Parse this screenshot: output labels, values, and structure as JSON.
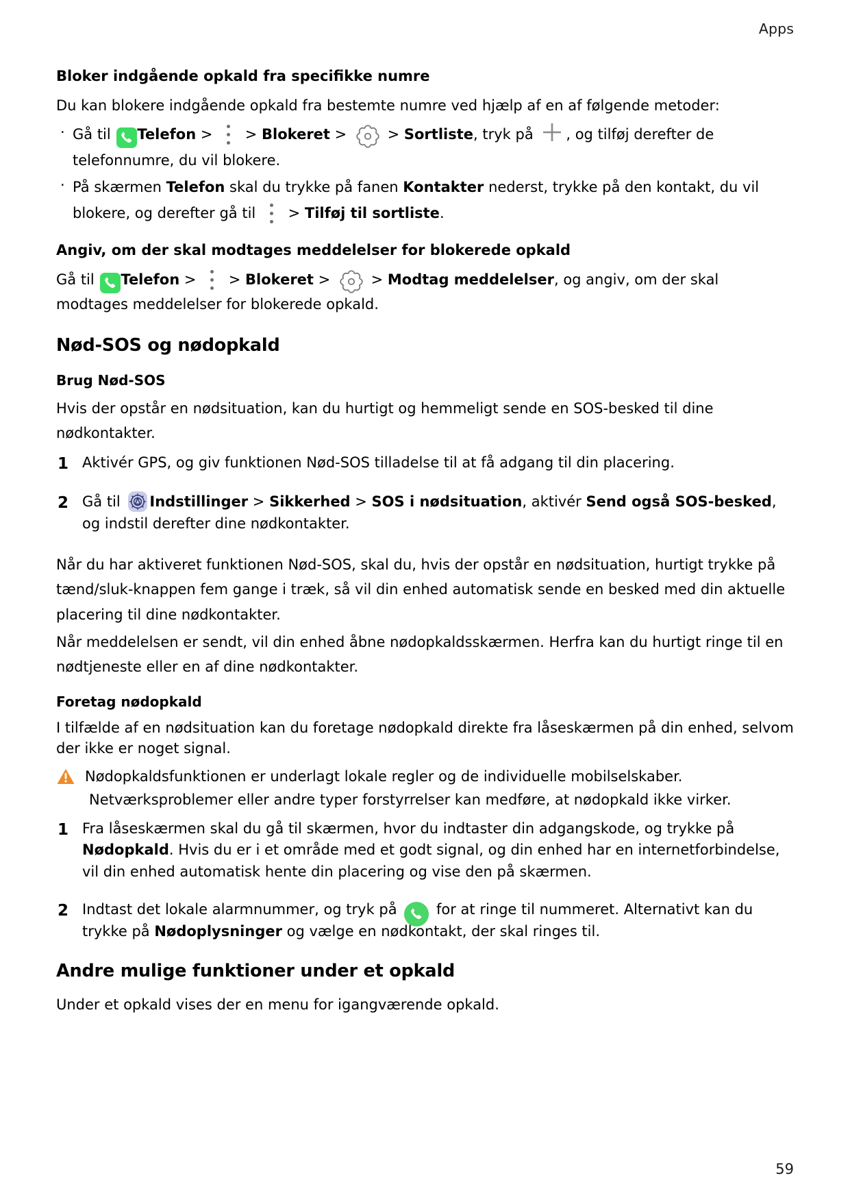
{
  "header": {
    "running_head": "Apps"
  },
  "footer": {
    "page_number": "59"
  },
  "sections": {
    "block_incoming": {
      "heading": "Bloker indgående opkald fra specifikke numre",
      "intro": "Du kan blokere indgående opkald fra bestemte numre ved hjælp af en af følgende metoder:",
      "bullet1": {
        "t1": "Gå til ",
        "app": "Telefon",
        "gt1": " > ",
        "gt2": " > ",
        "blocked": "Blokeret",
        "gt3": " > ",
        "gt4": " > ",
        "blacklist": "Sortliste",
        "t2": ", tryk på ",
        "t3": ", og tilføj derefter de telefonnumre, du vil blokere."
      },
      "bullet2": {
        "t1": "På skærmen ",
        "app": "Telefon",
        "t2": " skal du trykke på fanen ",
        "contacts": "Kontakter",
        "t3": " nederst, trykke på den kontakt, du vil blokere, og derefter gå til ",
        "gt1": " > ",
        "add_to_blacklist": "Tilføj til sortliste",
        "t4": "."
      }
    },
    "notifications": {
      "heading": "Angiv, om der skal modtages meddelelser for blokerede opkald",
      "p1": {
        "t1": "Gå til ",
        "app": "Telefon",
        "gt1": " > ",
        "gt2": " > ",
        "blocked": "Blokeret",
        "gt3": " > ",
        "gt4": " > ",
        "receive": "Modtag meddelelser",
        "t2": ", og angiv, om der skal modtages meddelelser for blokerede opkald."
      }
    },
    "sos": {
      "heading": "Nød-SOS og nødopkald",
      "use_sos": {
        "heading": "Brug Nød-SOS",
        "p1": "Hvis der opstår en nødsituation, kan du hurtigt og hemmeligt sende en SOS-besked til dine nødkontakter.",
        "step1": {
          "num": "1",
          "text": "Aktivér GPS, og giv funktionen Nød-SOS tilladelse til at få adgang til din placering."
        },
        "step2": {
          "num": "2",
          "t1": "Gå til ",
          "settings": "Indstillinger",
          "gt1": " > ",
          "security": "Sikkerhed",
          "gt2": " > ",
          "sos_emergency": "SOS i nødsituation",
          "t2": ", aktivér ",
          "send_sos": "Send også SOS-besked",
          "t3": ", og indstil derefter dine nødkontakter."
        },
        "p2": "Når du har aktiveret funktionen Nød-SOS, skal du, hvis der opstår en nødsituation, hurtigt trykke på tænd/sluk-knappen fem gange i træk, så vil din enhed automatisk sende en besked med din aktuelle placering til dine nødkontakter.",
        "p3": "Når meddelelsen er sendt, vil din enhed åbne nødopkaldsskærmen. Herfra kan du hurtigt ringe til en nødtjeneste eller en af dine nødkontakter."
      },
      "emergency_call": {
        "heading": "Foretag nødopkald",
        "p1": "I tilfælde af en nødsituation kan du foretage nødopkald direkte fra låseskærmen på din enhed, selvom der ikke er noget signal.",
        "note_line1": "Nødopkaldsfunktionen er underlagt lokale regler og de individuelle mobilselskaber.",
        "note_line2": "Netværksproblemer eller andre typer forstyrrelser kan medføre, at nødopkald ikke virker.",
        "step1": {
          "num": "1",
          "t1": "Fra låseskærmen skal du gå til skærmen, hvor du indtaster din adgangskode, og trykke på ",
          "emergency_call": "Nødopkald",
          "t2": ". Hvis du er i et område med et godt signal, og din enhed har en internetforbindelse, vil din enhed automatisk hente din placering og vise den på skærmen."
        },
        "step2": {
          "num": "2",
          "t1": "Indtast det lokale alarmnummer, og tryk på ",
          "t2": " for at ringe til nummeret. Alternativt kan du trykke på ",
          "emergency_info": "Nødoplysninger",
          "t3": " og vælge en nødkontakt, der skal ringes til."
        }
      }
    },
    "other_functions": {
      "heading": "Andre mulige funktioner under et opkald",
      "p1": "Under et opkald vises der en menu for igangværende opkald."
    }
  },
  "icons": {
    "phone_app": "phone-app-icon",
    "kebab_menu": "kebab-menu-icon",
    "gear": "gear-icon",
    "plus": "plus-icon",
    "settings_app": "settings-app-icon",
    "phone_call": "phone-call-icon",
    "warning": "warning-icon"
  },
  "colors": {
    "phone_green": "#3ddc63",
    "phone_circle_green": "#4ad668",
    "gear_gray": "#6e6e6e",
    "warning_orange": "#ee8c2a",
    "settings_bg": "#c9cde8",
    "settings_fg": "#2b3470",
    "text": "#000000"
  }
}
